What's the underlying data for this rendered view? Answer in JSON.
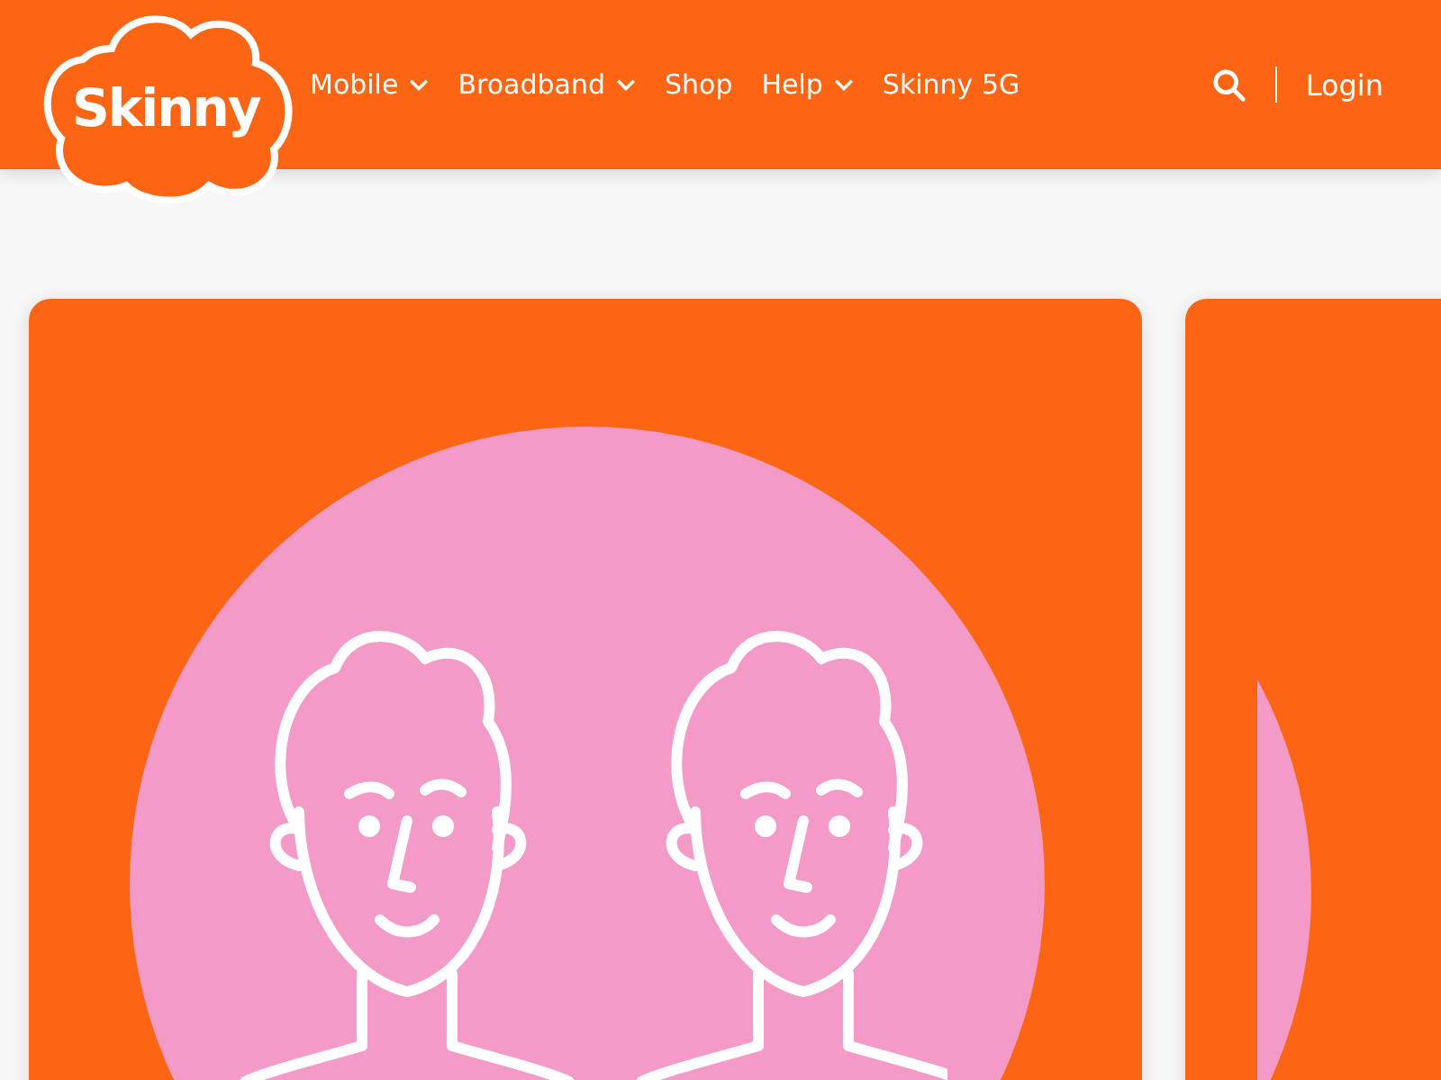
{
  "header": {
    "logo": "Skinny",
    "nav": [
      {
        "label": "Mobile",
        "has_dropdown": true
      },
      {
        "label": "Broadband",
        "has_dropdown": true
      },
      {
        "label": "Shop",
        "has_dropdown": false
      },
      {
        "label": "Help",
        "has_dropdown": true
      },
      {
        "label": "Skinny 5G",
        "has_dropdown": false
      }
    ],
    "login": "Login"
  },
  "cards": [
    {
      "kind": "full"
    },
    {
      "kind": "partial"
    }
  ]
}
